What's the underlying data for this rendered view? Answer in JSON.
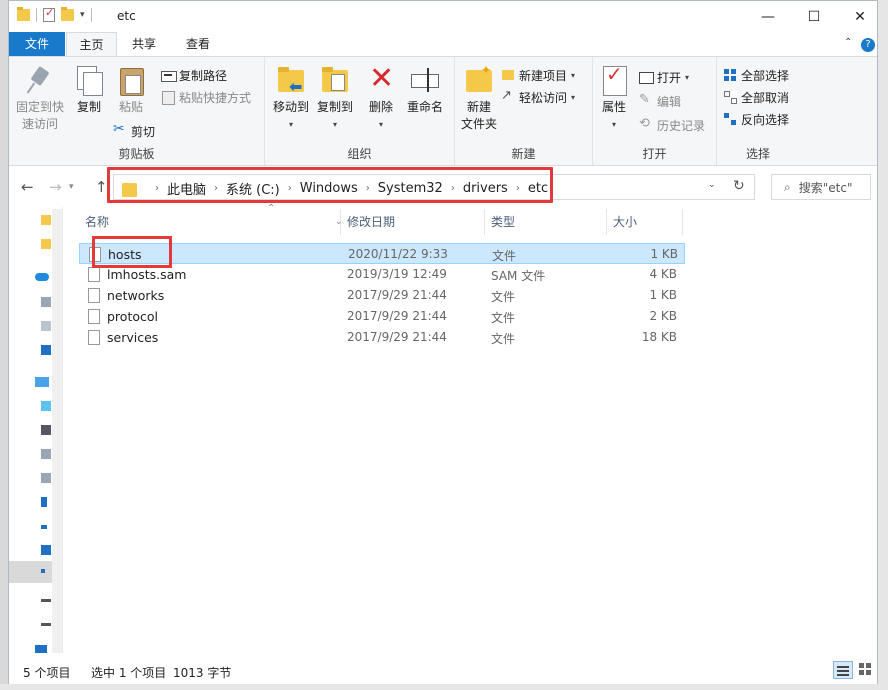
{
  "window": {
    "title": "etc"
  },
  "titlebar": {
    "minimize": "—",
    "maximize": "☐",
    "close": "✕"
  },
  "tabs": {
    "file": "文件",
    "home": "主页",
    "share": "共享",
    "view": "查看"
  },
  "ribbon": {
    "clipboard": {
      "label": "剪贴板",
      "pin": "固定到快\n速访问",
      "copy": "复制",
      "paste": "粘贴",
      "copy_path": "复制路径",
      "paste_shortcut": "粘贴快捷方式",
      "cut": "剪切"
    },
    "organize": {
      "label": "组织",
      "move_to": "移动到",
      "copy_to": "复制到",
      "delete": "删除",
      "rename": "重命名"
    },
    "new": {
      "label": "新建",
      "new_folder": "新建\n文件夹",
      "new_item": "新建项目",
      "easy_access": "轻松访问"
    },
    "open": {
      "label": "打开",
      "properties": "属性",
      "open": "打开",
      "edit": "编辑",
      "history": "历史记录"
    },
    "select": {
      "label": "选择",
      "select_all": "全部选择",
      "select_none": "全部取消",
      "invert": "反向选择"
    }
  },
  "address": {
    "crumbs": [
      "此电脑",
      "系统 (C:)",
      "Windows",
      "System32",
      "drivers",
      "etc"
    ]
  },
  "search": {
    "placeholder": "搜索\"etc\""
  },
  "columns": {
    "name": "名称",
    "date": "修改日期",
    "type": "类型",
    "size": "大小"
  },
  "files": [
    {
      "name": "hosts",
      "date": "2020/11/22 9:33",
      "type": "文件",
      "size": "1 KB",
      "selected": true
    },
    {
      "name": "lmhosts.sam",
      "date": "2019/3/19 12:49",
      "type": "SAM 文件",
      "size": "4 KB",
      "selected": false
    },
    {
      "name": "networks",
      "date": "2017/9/29 21:44",
      "type": "文件",
      "size": "1 KB",
      "selected": false
    },
    {
      "name": "protocol",
      "date": "2017/9/29 21:44",
      "type": "文件",
      "size": "2 KB",
      "selected": false
    },
    {
      "name": "services",
      "date": "2017/9/29 21:44",
      "type": "文件",
      "size": "18 KB",
      "selected": false
    }
  ],
  "status": {
    "count": "5 个项目",
    "selected": "选中 1 个项目",
    "size": "1013 字节"
  },
  "colors": {
    "accent": "#1979ca",
    "selection": "#cce8ff",
    "highlight": "#e23a3a"
  }
}
